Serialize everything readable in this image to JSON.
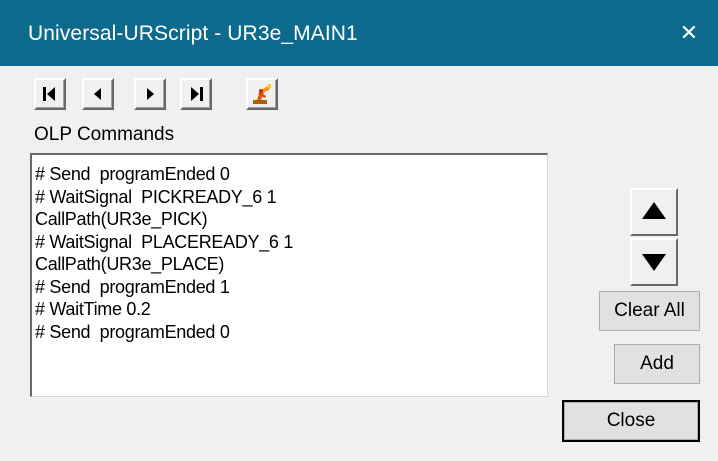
{
  "window": {
    "title": "Universal-URScript - UR3e_MAIN1",
    "close_glyph": "✕",
    "titlebar_color": "#0e6a8c"
  },
  "toolbar": {
    "buttons": [
      {
        "name": "first-icon"
      },
      {
        "name": "previous-icon"
      },
      {
        "name": "next-icon"
      },
      {
        "name": "last-icon"
      },
      {
        "name": "robot-icon"
      }
    ]
  },
  "commands": {
    "label": "OLP Commands",
    "items": [
      "# Send  programEnded 0",
      "# WaitSignal  PICKREADY_6 1",
      "CallPath(UR3e_PICK)",
      "# WaitSignal  PLACEREADY_6 1",
      "CallPath(UR3e_PLACE)",
      "# Send  programEnded 1",
      "# WaitTime 0.2",
      "# Send  programEnded 0"
    ]
  },
  "buttons": {
    "move_up_icon": "triangle-up-icon",
    "move_down_icon": "triangle-down-icon",
    "clear_all": "Clear All",
    "add": "Add",
    "close": "Close"
  }
}
